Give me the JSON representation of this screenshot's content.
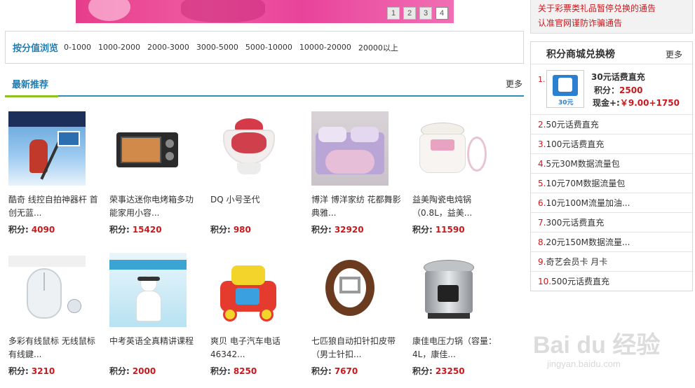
{
  "banner": {
    "pages": [
      "1",
      "2",
      "3",
      "4"
    ],
    "active_page": "4",
    "colors": {
      "bg": "#e63d8b",
      "accent": "#c52a78"
    }
  },
  "browse": {
    "label": "按分值浏览",
    "ranges": [
      "0-1000",
      "1000-2000",
      "2000-3000",
      "3000-5000",
      "5000-10000",
      "10000-20000",
      "20000以上"
    ]
  },
  "section": {
    "title": "最新推荐",
    "more": "更多"
  },
  "points_label": "积分:",
  "products": [
    {
      "name": "酷奇 线控自拍神器杆 首创无蓝...",
      "points": "4090",
      "icon": "selfie-stick-image"
    },
    {
      "name": "荣事达迷你电烤箱多功能家用小容...",
      "points": "15420",
      "icon": "toaster-oven-image"
    },
    {
      "name": "DQ 小号圣代",
      "points": "980",
      "icon": "sundae-image"
    },
    {
      "name": "博洋 博洋家纺 花都舞影 典雅...",
      "points": "32920",
      "icon": "bedding-set-image"
    },
    {
      "name": "益美陶瓷电炖锅（0.8L，益美...",
      "points": "11590",
      "icon": "stew-pot-image"
    },
    {
      "name": "多彩有线鼠标 无线鼠标 有线鍵...",
      "points": "3210",
      "icon": "mouse-image"
    },
    {
      "name": "中考英语全真精讲课程",
      "points": "2000",
      "icon": "english-course-image"
    },
    {
      "name": "爽贝 电子汽车电话 46342...",
      "points": "8250",
      "icon": "toy-car-phone-image"
    },
    {
      "name": "七匹狼自动扣针扣皮带（男士针扣...",
      "points": "7670",
      "icon": "leather-belt-image"
    },
    {
      "name": "康佳电压力锅（容量：4L，康佳...",
      "points": "23250",
      "icon": "pressure-cooker-image"
    }
  ],
  "sidebar": {
    "notices": [
      "关于彩票类礼品暂停兑换的通告",
      "认准官网谨防诈骗通告"
    ],
    "rank_title": "积分商城兑换榜",
    "rank_more": "更多",
    "top1": {
      "num": "1.",
      "name": "30元话费直充",
      "points_label": "积分：",
      "points": "2500",
      "cash_label": "现金+:",
      "cash": "￥9.00+1750",
      "thumb_text": "30元"
    },
    "rank_items": [
      {
        "num": "2.",
        "name": "50元话费直充"
      },
      {
        "num": "3.",
        "name": "100元话费直充"
      },
      {
        "num": "4.",
        "name": "5元30M数据流量包"
      },
      {
        "num": "5.",
        "name": "10元70M数据流量包"
      },
      {
        "num": "6.",
        "name": "10元100M流量加油..."
      },
      {
        "num": "7.",
        "name": "300元话费直充"
      },
      {
        "num": "8.",
        "name": "20元150M数据流量..."
      },
      {
        "num": "9.",
        "name": "奇艺会员卡 月卡"
      },
      {
        "num": "10.",
        "name": "500元话费直充"
      }
    ]
  },
  "watermark": {
    "logo": "Bai du 经验",
    "url": "jingyan.baidu.com"
  },
  "colors": {
    "link_blue": "#1f7fb5",
    "points_red": "#c9191d",
    "underline_green": "#8ec31f"
  }
}
